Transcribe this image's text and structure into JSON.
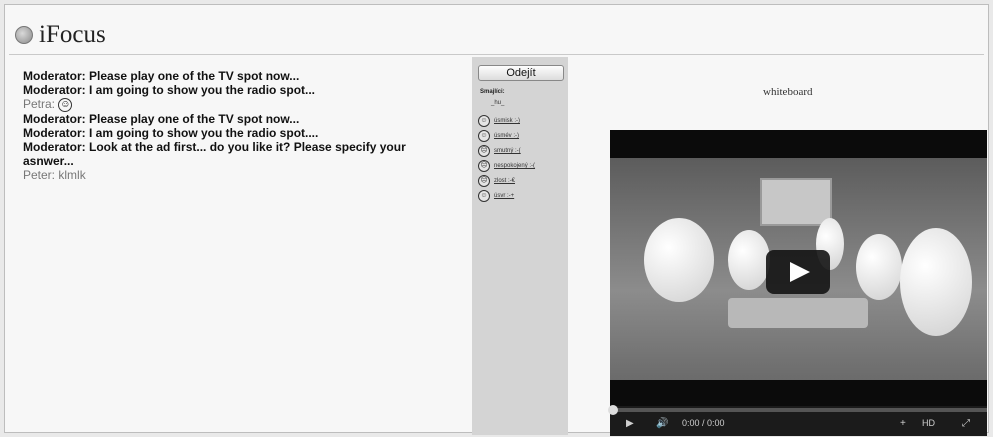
{
  "app": {
    "title": "iFocus"
  },
  "chat": {
    "messages": [
      {
        "author": "Moderator:",
        "text": "Please play one of the TV spot now..."
      },
      {
        "author": "Moderator:",
        "text": "I am going to show you the radio spot..."
      },
      {
        "author": "Petra:",
        "text": "☺"
      },
      {
        "author": "Moderator:",
        "text": "Please play one of the TV spot now..."
      },
      {
        "author": "Moderator:",
        "text": "I am going to show you the radio spot...."
      },
      {
        "author": "Moderator:",
        "text": "Look at the ad first... do you like it? Please specify your asnwer..."
      },
      {
        "author": "Peter:",
        "text": "klmlk"
      }
    ]
  },
  "sidebar": {
    "leave_label": "Odejít",
    "smiles_title": "Smajlíci:",
    "smiles_sub": "_hu_",
    "emotes": [
      {
        "face": "☺",
        "label": "úsmisk :-)"
      },
      {
        "face": "☺",
        "label": "úsmév :-)"
      },
      {
        "face": "☹",
        "label": "smutný :-("
      },
      {
        "face": "☹",
        "label": "nespokojený :-("
      },
      {
        "face": "☹",
        "label": "zlost :-€"
      },
      {
        "face": "☺",
        "label": "úsvr :-+"
      }
    ]
  },
  "whiteboard": {
    "label": "whiteboard"
  },
  "video": {
    "time": "0:00 / 0:00",
    "hd": "HD"
  }
}
